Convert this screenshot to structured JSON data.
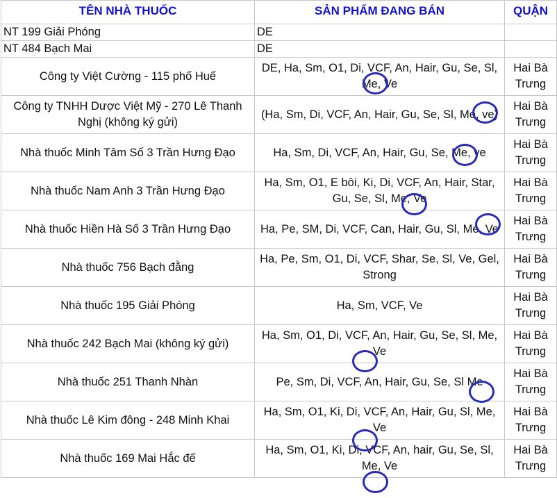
{
  "headers": {
    "name": "TÊN NHÀ THUỐC",
    "products": "SẢN PHẨM ĐANG BÁN",
    "district": "QUẬN"
  },
  "rows": [
    {
      "name": "NT 199 Giải Phóng",
      "products": "DE",
      "district": ""
    },
    {
      "name": "NT 484 Bạch Mai",
      "products": "DE",
      "district": ""
    },
    {
      "name": "Công ty Việt Cường - 115 phố Huế",
      "products": "DE, Ha, Sm, O1, Di, VCF, An, Hair, Gu, Se, Sl, Me, Ve",
      "district": "Hai Bà Trưng"
    },
    {
      "name": "Công ty TNHH Dược Việt Mỹ - 270 Lê Thanh Nghị (không ký gửi)",
      "products": "(Ha, Sm, Di, VCF, An, Hair, Gu, Se, Sl, Me, ve)",
      "district": "Hai Bà Trưng"
    },
    {
      "name": "Nhà thuốc Minh Tâm Số 3 Trần Hưng Đạo",
      "products": "Ha, Sm, Di, VCF, An, Hair, Gu, Se, Me, ve",
      "district": "Hai Bà Trưng"
    },
    {
      "name": "Nhà thuốc Nam Anh 3 Trần Hưng Đạo",
      "products": "Ha, Sm, O1, E bôi, Ki, Di, VCF, An, Hair, Star, Gu, Se, Sl, Me, Ve",
      "district": "Hai Bà Trưng"
    },
    {
      "name": "Nhà thuốc Hiền Hà Số 3 Trần Hưng Đạo",
      "products": "Ha, Pe, SM, Di, VCF, Can, Hair, Gu, Sl, Me, Ve",
      "district": "Hai Bà Trưng"
    },
    {
      "name": "Nhà thuốc 756 Bạch đằng",
      "products": "Ha, Pe, Sm, O1, Di, VCF, Shar, Se, Sl, Ve, Gel, Strong",
      "district": "Hai Bà Trưng"
    },
    {
      "name": "Nhà thuốc 195 Giải Phóng",
      "products": "Ha, Sm, VCF, Ve",
      "district": "Hai Bà Trưng"
    },
    {
      "name": "Nhà thuốc 242 Bạch Mai (không ký gửi)",
      "products": "Ha, Sm, O1, Di, VCF, An, Hair, Gu, Se, Sl, Me, Ve",
      "district": "Hai Bà Trưng"
    },
    {
      "name": "Nhà thuốc 251 Thanh Nhàn",
      "products": "Pe, Sm, Di, VCF, An, Hair, Gu, Se, Sl Me",
      "district": "Hai Bà Trưng"
    },
    {
      "name": "Nhà thuốc Lê Kim đông - 248 Minh Khai",
      "products": "Ha, Sm, O1, Ki, Di, VCF, An, Hair, Gu, Sl, Me, Ve",
      "district": "Hai Bà Trưng"
    },
    {
      "name": "Nhà thuốc 169 Mai Hắc đế",
      "products": "Ha, Sm, O1, Ki, Di, VCF, An, hair, Gu, Se, Sl, Me, Ve",
      "district": "Hai Bà Trưng"
    }
  ],
  "annotation_color": "#2a2ab8"
}
